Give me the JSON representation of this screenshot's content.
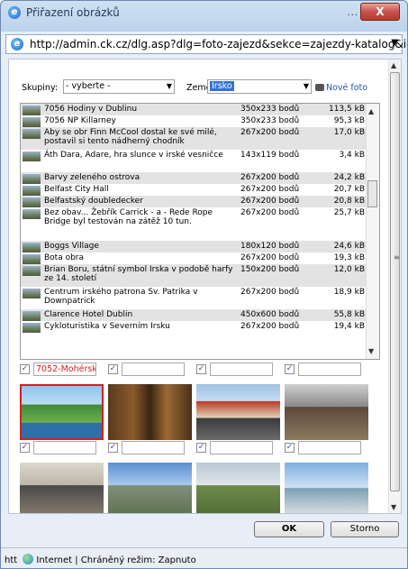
{
  "window": {
    "title": "Přiřazení obrázků",
    "close_label": "X",
    "dots": "..."
  },
  "address": {
    "url": "http://admin.ck.cz/dlg.asp?dlg=foto-zajezd&sekce=zajezdy-katalog&id=7"
  },
  "filter": {
    "groups_label": "Skupiny:",
    "groups_value": "- vyberte -",
    "country_label": "Země:",
    "country_value": "Irsko",
    "new_photo_label": "Nové foto"
  },
  "list": [
    {
      "name": "7056 Hodiny v Dublinu",
      "size": "350x233 bodů",
      "kb": "113,5 kB"
    },
    {
      "name": "7056 NP Killarney",
      "size": "350x233 bodů",
      "kb": "95,3 kB"
    },
    {
      "name": "Aby se obr Finn McCool dostal ke své milé, postavil si tento nádherný chodník",
      "size": "267x200 bodů",
      "kb": "17,0 kB"
    },
    {
      "name": "Áth Dara, Adare, hra slunce v irské vesničce",
      "size": "143x119 bodů",
      "kb": "3,4 kB"
    },
    {
      "name": "Barvy zeleného ostrova",
      "size": "267x200 bodů",
      "kb": "24,2 kB"
    },
    {
      "name": "Belfast City Hall",
      "size": "267x200 bodů",
      "kb": "20,7 kB"
    },
    {
      "name": "Belfastský doubledecker",
      "size": "267x200 bodů",
      "kb": "20,8 kB"
    },
    {
      "name": "Bez obav... Žebřík Carrick - a - Rede Rope Bridge byl testován na zátěž 10 tun.",
      "size": "267x200 bodů",
      "kb": "25,7 kB"
    },
    {
      "name": "Boggs Village",
      "size": "180x120 bodů",
      "kb": "24,6 kB"
    },
    {
      "name": "Bota obra",
      "size": "267x200 bodů",
      "kb": "19,3 kB"
    },
    {
      "name": "Brian Boru, státní symbol Irska v podobě harfy ze 14. století",
      "size": "150x200 bodů",
      "kb": "12,0 kB"
    },
    {
      "name": "Centrum irského patrona Sv. Patrika v Downpatrick",
      "size": "267x200 bodů",
      "kb": "18,9 kB"
    },
    {
      "name": "Clarence Hotel Dublin",
      "size": "450x600 bodů",
      "kb": "55,8 kB"
    },
    {
      "name": "Cykloturistika v Severním Irsku",
      "size": "267x200 bodů",
      "kb": "19,4 kB"
    }
  ],
  "photos": [
    {
      "label": "7052-Mohérsk",
      "selected": true
    },
    {
      "label": "",
      "selected": false
    },
    {
      "label": "",
      "selected": false
    },
    {
      "label": "",
      "selected": false
    },
    {
      "label": "",
      "selected": false
    },
    {
      "label": "",
      "selected": false
    },
    {
      "label": "",
      "selected": false
    },
    {
      "label": "",
      "selected": false
    }
  ],
  "buttons": {
    "ok": "OK",
    "cancel": "Storno"
  },
  "status": {
    "text": "htt",
    "zone": "Internet | Chráněný režim: Zapnuto"
  }
}
